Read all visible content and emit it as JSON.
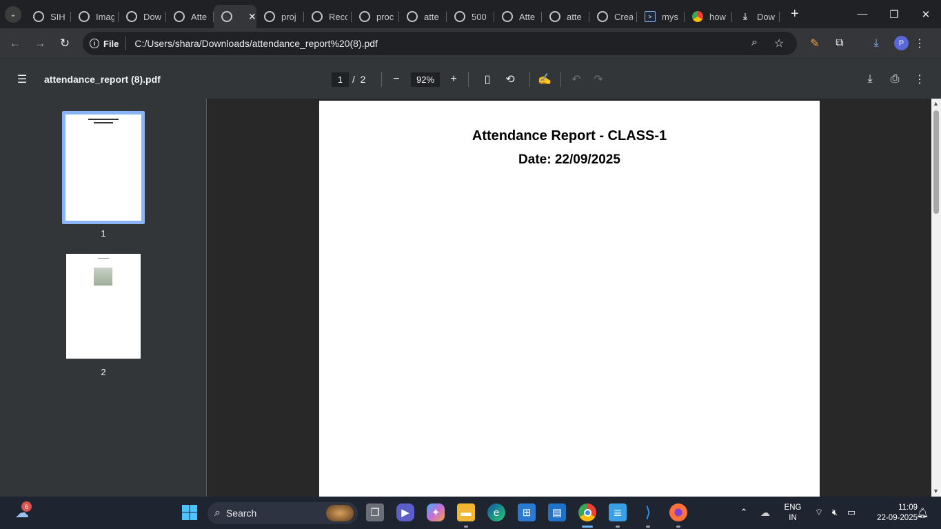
{
  "tabs": [
    {
      "label": "SIH",
      "icon": "chatgpt-icon"
    },
    {
      "label": "Imag",
      "icon": "chatgpt-icon"
    },
    {
      "label": "Dow",
      "icon": "github-icon"
    },
    {
      "label": "Atte",
      "icon": "globe-icon"
    },
    {
      "label": "",
      "icon": "globe-icon",
      "active": true
    },
    {
      "label": "proj",
      "icon": "app-icon"
    },
    {
      "label": "Reco",
      "icon": "globe-icon"
    },
    {
      "label": "proc",
      "icon": "globe-icon"
    },
    {
      "label": "atte",
      "icon": "globe-icon"
    },
    {
      "label": "500",
      "icon": "globe-icon"
    },
    {
      "label": "Atte",
      "icon": "globe-icon"
    },
    {
      "label": "atte",
      "icon": "globe-icon"
    },
    {
      "label": "Crea",
      "icon": "globe-icon"
    },
    {
      "label": "mys",
      "icon": "terminal-icon"
    },
    {
      "label": "how",
      "icon": "google-icon"
    },
    {
      "label": "Dow",
      "icon": "download-icon"
    }
  ],
  "address": {
    "chip": "File",
    "url": "C:/Users/shara/Downloads/attendance_report%20(8).pdf"
  },
  "profile_initial": "P",
  "pdf_viewer": {
    "title": "attendance_report (8).pdf",
    "current_page": "1",
    "separator": "/",
    "total_pages": "2",
    "zoom": "92%"
  },
  "thumbnails": [
    {
      "number": "1"
    },
    {
      "number": "2"
    }
  ],
  "document": {
    "heading": "Attendance Report - CLASS-1",
    "date_line": "Date: 22/09/2025"
  },
  "taskbar": {
    "search_label": "Search",
    "weather_badge": "6",
    "lang_top": "ENG",
    "lang_bottom": "IN",
    "time": "11:09",
    "date": "22-09-2025"
  }
}
